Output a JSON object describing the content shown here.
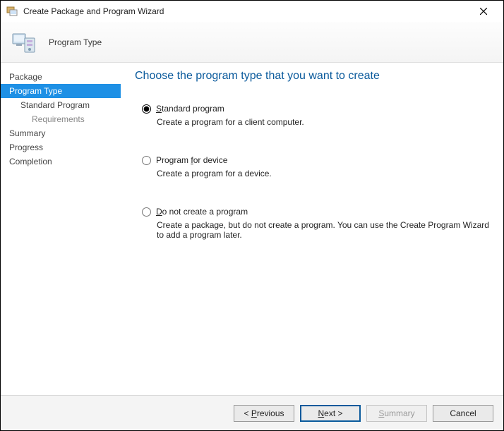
{
  "window": {
    "title": "Create Package and Program Wizard"
  },
  "header": {
    "title": "Program Type"
  },
  "nav": {
    "package": "Package",
    "programType": "Program Type",
    "standardProgram": "Standard Program",
    "requirements": "Requirements",
    "summary": "Summary",
    "progress": "Progress",
    "completion": "Completion"
  },
  "content": {
    "heading": "Choose the program type that you want to create",
    "opt1": {
      "label_pre": "",
      "label_u": "S",
      "label_post": "tandard program",
      "desc": "Create a program for a client computer."
    },
    "opt2": {
      "label_pre": "Program ",
      "label_u": "f",
      "label_post": "or device",
      "desc": "Create a program for a device."
    },
    "opt3": {
      "label_pre": "",
      "label_u": "D",
      "label_post": "o not create a program",
      "desc": "Create a package, but do not create a program. You can use the Create Program Wizard to add a program later."
    }
  },
  "footer": {
    "prev_pre": "< ",
    "prev_u": "P",
    "prev_post": "revious",
    "next_pre": "",
    "next_u": "N",
    "next_post": "ext >",
    "summary_pre": "",
    "summary_u": "S",
    "summary_post": "ummary",
    "cancel": "Cancel"
  }
}
